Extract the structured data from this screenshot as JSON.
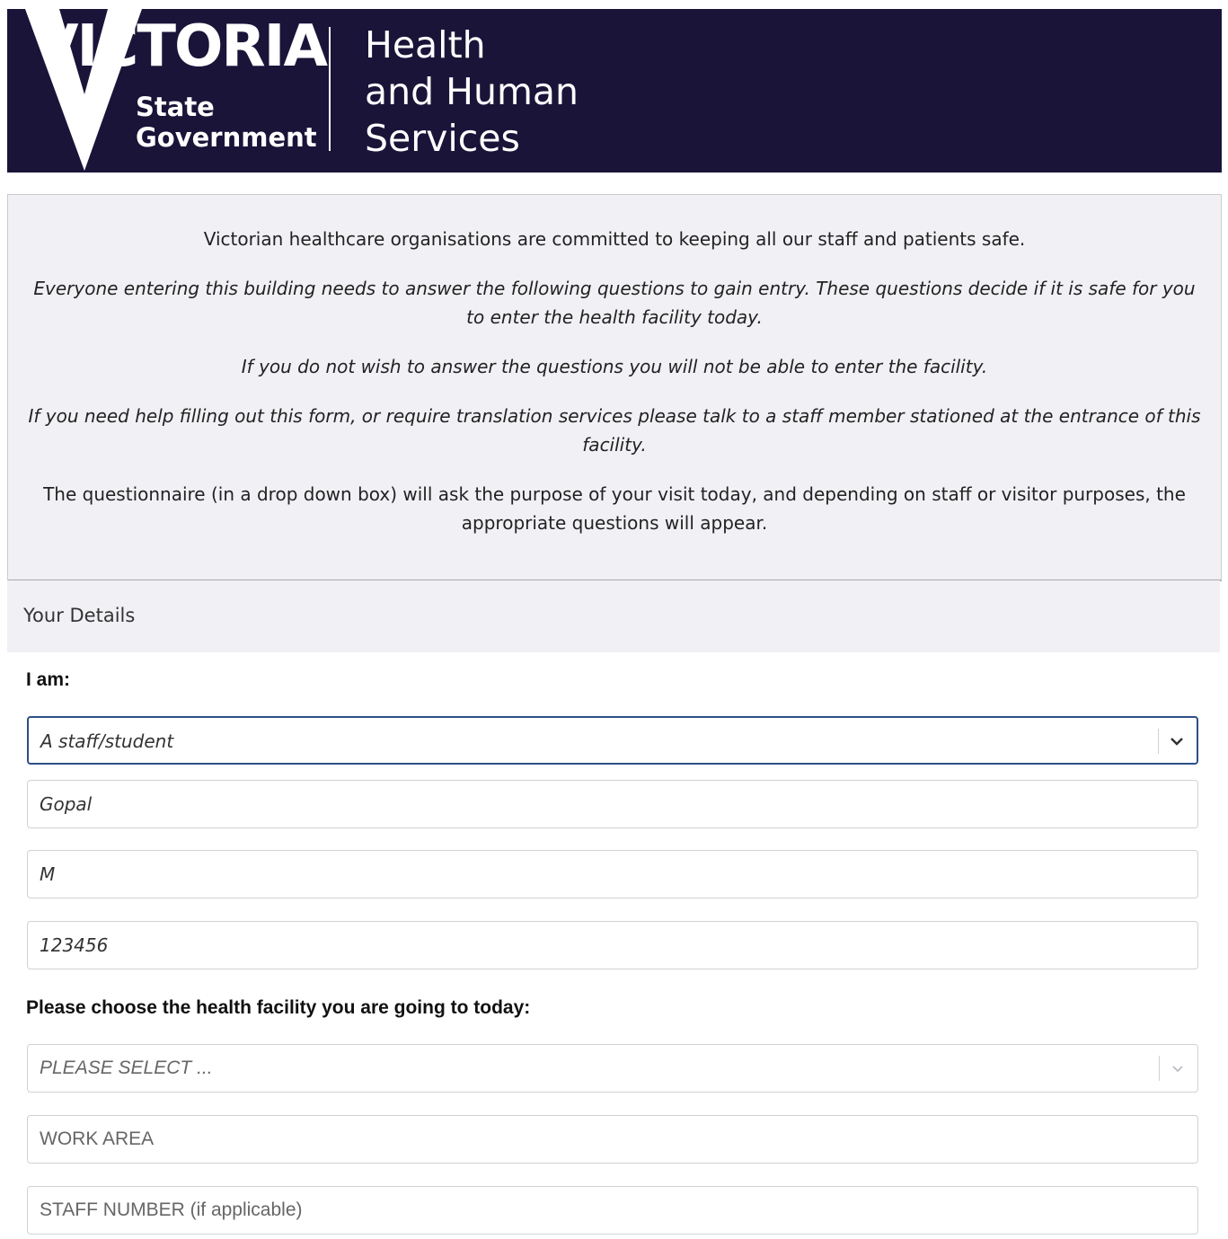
{
  "header": {
    "logo_word": "VICTORIA",
    "logo_sub": [
      "State",
      "Government"
    ],
    "department": [
      "Health",
      "and Human",
      "Services"
    ],
    "background_color": "#1a1439"
  },
  "info": {
    "line1": "Victorian healthcare organisations are committed to keeping all our staff and patients safe.",
    "line2": "Everyone entering this building needs to answer the following questions to gain entry. These questions decide if it is safe for you to enter the health facility today.",
    "line3": "If you do not wish to answer the questions you will not be able to enter the facility.",
    "line4": "If you need help filling out this form, or require translation services please talk to a staff member stationed at the entrance of this facility.",
    "line5": "The questionnaire (in a drop down box) will ask the purpose of your visit today, and depending on staff or visitor purposes, the appropriate questions will appear."
  },
  "form": {
    "section_title": "Your Details",
    "i_am_label": "I am:",
    "i_am_value": "A staff/student",
    "first_name": "Gopal",
    "last_name": "M",
    "phone": "123456",
    "facility_label": "Please choose the health facility you are going to today:",
    "facility_placeholder": "PLEASE SELECT ...",
    "work_area_placeholder": "WORK AREA",
    "staff_number_placeholder": "STAFF NUMBER (if applicable)",
    "icons": [
      "chevron-down-icon"
    ],
    "accent_color": "#2d4f86"
  }
}
